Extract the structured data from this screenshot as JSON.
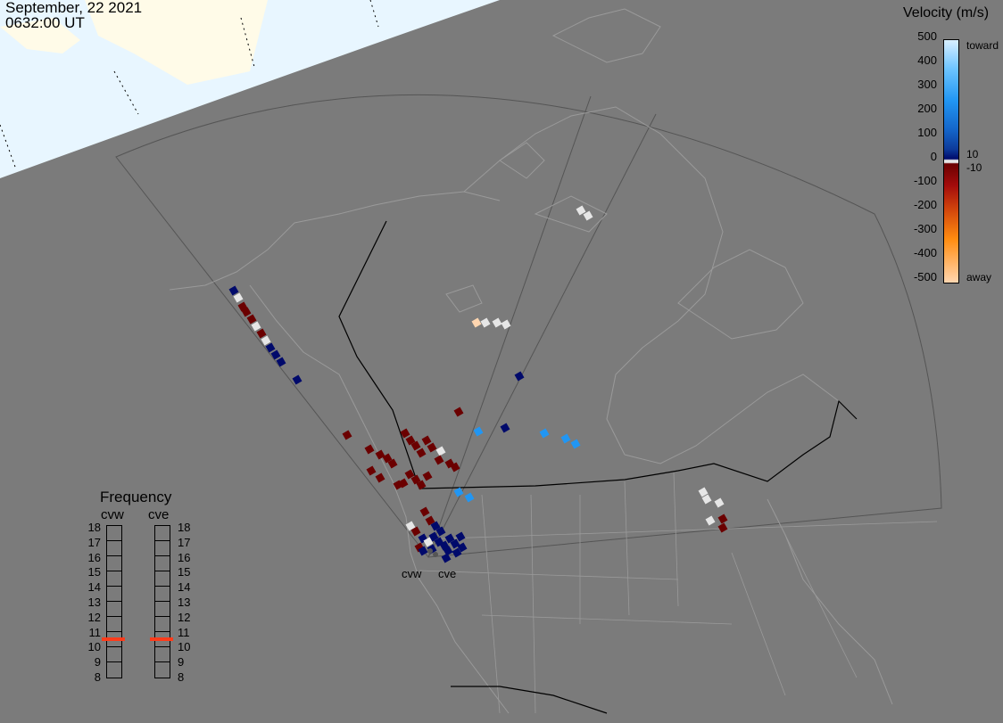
{
  "title": {
    "date": "September, 22 2021",
    "time": "0632:00 UT"
  },
  "velocity_legend": {
    "title": "Velocity (m/s)",
    "ticks": [
      "500",
      "400",
      "300",
      "200",
      "100",
      "0",
      "-100",
      "-200",
      "-300",
      "-400",
      "-500"
    ],
    "toward_label": "toward",
    "away_label": "away",
    "pos_threshold": "10",
    "neg_threshold": "-10",
    "colors": {
      "toward_high": "#d8efff",
      "toward_mid": "#2196f3",
      "toward_low": "#000a6b",
      "ground_scatter": "#e6e6e6",
      "away_low": "#6b0000",
      "away_mid": "#d2460c",
      "away_high": "#ffd6b0"
    }
  },
  "frequency_legend": {
    "title": "Frequency",
    "radars": [
      "cvw",
      "cve"
    ],
    "scale": [
      "18",
      "17",
      "16",
      "15",
      "14",
      "13",
      "12",
      "11",
      "10",
      "9",
      "8"
    ],
    "cvw_frequency_mhz": 10.5,
    "cve_frequency_mhz": 10.5,
    "marker_color": "#ff3b1a"
  },
  "sites": {
    "west": "cvw",
    "east": "cve"
  },
  "map": {
    "background_color": "#7b7b7b",
    "daylight_color": "#fffbe8",
    "ocean_day_color": "#e8f6ff",
    "outline_color": "#9a9a9a",
    "border_color": "#000000"
  }
}
